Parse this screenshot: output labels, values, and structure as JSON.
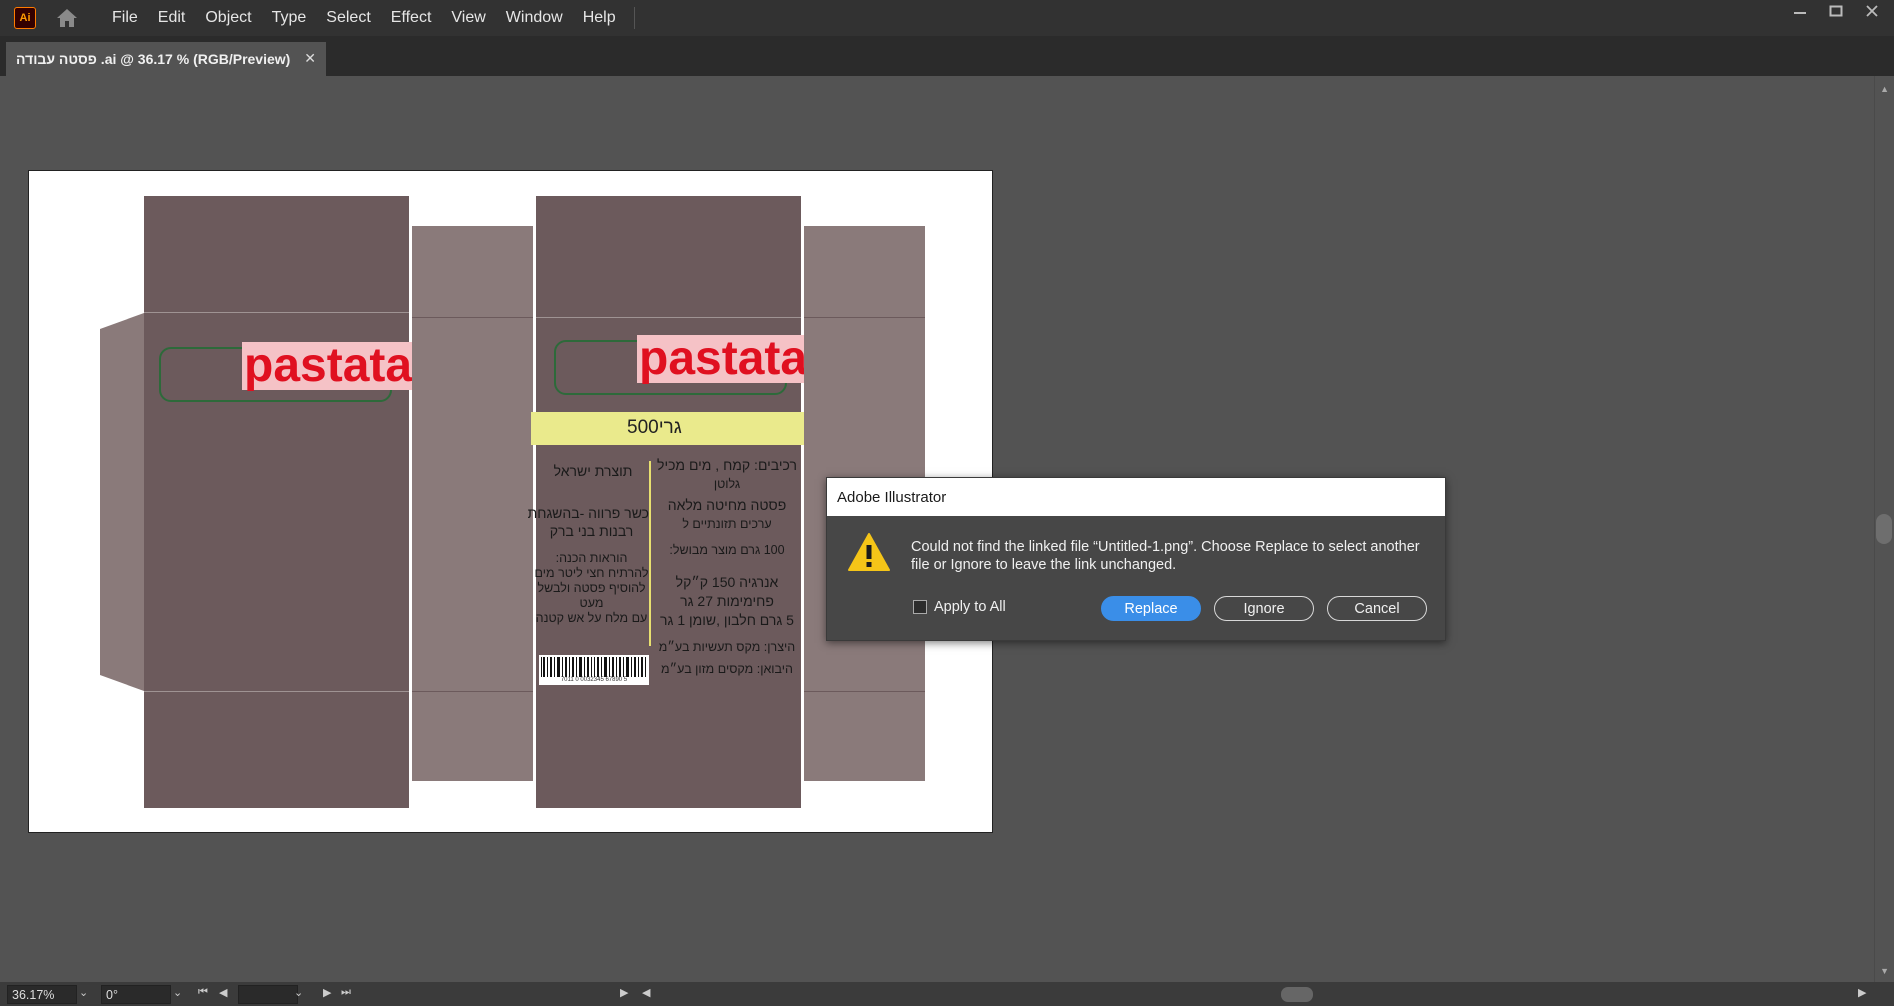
{
  "app": {
    "logo": "Ai"
  },
  "menu": [
    "File",
    "Edit",
    "Object",
    "Type",
    "Select",
    "Effect",
    "View",
    "Window",
    "Help"
  ],
  "tab": {
    "title": "פסטה עבודה .ai @ 36.17 % (RGB/Preview)",
    "close": "✕"
  },
  "artwork": {
    "brand": "pastata",
    "weight": "500גרי",
    "made_in": "תוצרת ישראל",
    "kosher_1": "כשר פרווה -בהשגחת",
    "kosher_2": "רבנות בני ברק",
    "instructions_1": "הוראות הכנה:",
    "instructions_2": "להרתיח חצי ליטר מים",
    "instructions_3": "להוסיף פסטה ולבשל",
    "instructions_4": "מעט",
    "instructions_5": "עם מלח  על אש קטנה",
    "ingredients_1": "רכיבים: קמח , מים מכיל",
    "ingredients_2": "גלוטן",
    "ingredients_3": "פסטה  מחיטה מלאה",
    "ingredients_4": "ערכים תזונתיים ל",
    "ingredients_5": "100 גרם מוצר מבושל:",
    "nutrition_1": "אנרגיה 150 ק״קל",
    "nutrition_2": "פחימימות 27 גר",
    "nutrition_3": "5 גרם חלבון ,שומן 1 גר",
    "producer": "היצרן: מקס תעשיות בע״מ",
    "importer": "היבואן: מקסים  מזון בע״מ",
    "barcode_digits": "7011 0 0032345 67890 5"
  },
  "dialog": {
    "title": "Adobe Illustrator",
    "message": "Could not find the linked file “Untitled-1.png”. Choose Replace to select another file or Ignore to leave the link unchanged.",
    "apply_all": "Apply to All",
    "replace": "Replace",
    "ignore": "Ignore",
    "cancel": "Cancel"
  },
  "status": {
    "zoom": "36.17%",
    "rotation": "0°"
  },
  "colors": {
    "accent": "#3a8ee8",
    "warning": "#f5c518",
    "brand_red": "#e01020"
  }
}
